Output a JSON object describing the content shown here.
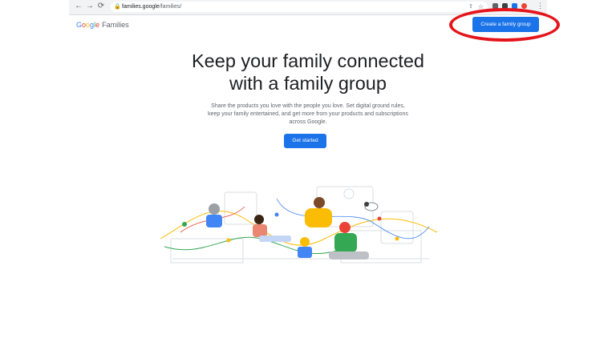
{
  "browser": {
    "back_icon": "back-arrow-icon",
    "forward_icon": "forward-arrow-icon",
    "reload_icon": "reload-icon",
    "url_domain": "families.google",
    "url_path": "/families/",
    "share_icon": "share-icon",
    "star_icon": "star-icon",
    "menu_icon": "menu-dots-icon",
    "menu_glyph": "⋮"
  },
  "header": {
    "logo_letters": [
      "G",
      "o",
      "o",
      "g",
      "l",
      "e"
    ],
    "product": "Families",
    "create_button": "Create a family group"
  },
  "hero": {
    "headline_line1": "Keep your family connected",
    "headline_line2": "with a family group",
    "subtext": "Share the products you love with the people you love. Set digital ground rules, keep your family entertained, and get more from your products and subscriptions across Google.",
    "cta": "Get started"
  },
  "colors": {
    "accent": "#1a73e8",
    "annotation": "#e5141b",
    "google_blue": "#4285f4",
    "google_red": "#ea4335",
    "google_yellow": "#fbbc05",
    "google_green": "#34a853"
  }
}
